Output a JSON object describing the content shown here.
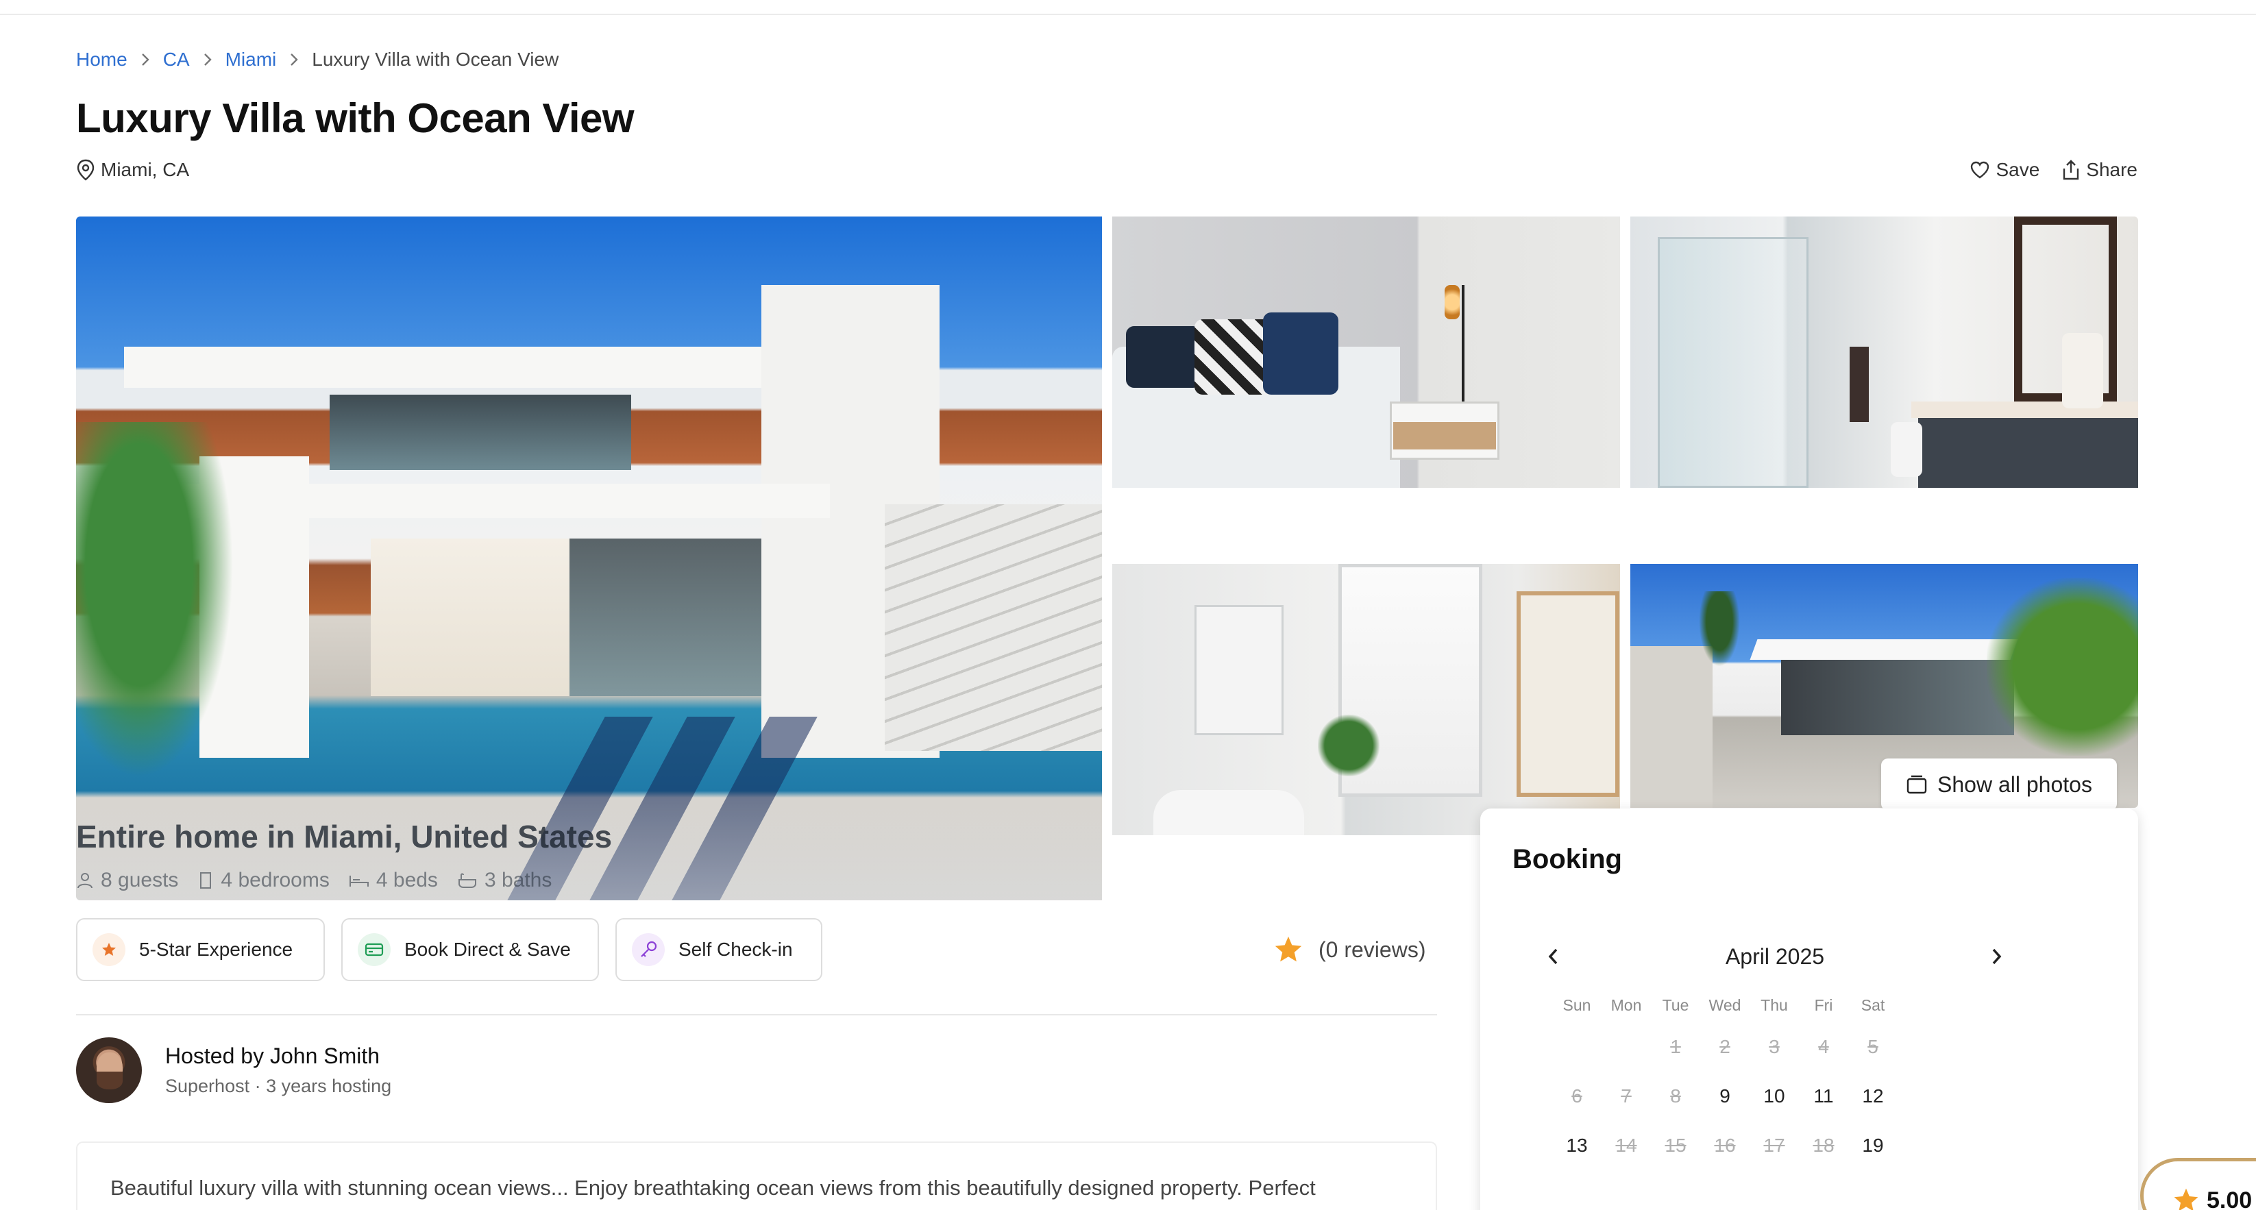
{
  "breadcrumb": {
    "items": [
      {
        "label": "Home"
      },
      {
        "label": "CA"
      },
      {
        "label": "Miami"
      }
    ],
    "current": "Luxury Villa with Ocean View"
  },
  "listing": {
    "title": "Luxury Villa with Ocean View",
    "location": "Miami, CA"
  },
  "actions": {
    "save_label": "Save",
    "share_label": "Share"
  },
  "gallery": {
    "caption_title": "Entire home in Miami, United States",
    "facts": [
      "8 guests",
      "4 bedrooms",
      "4 beds",
      "3 baths"
    ],
    "show_all_label": "Show all photos"
  },
  "highlights": [
    {
      "label": "5-Star Experience",
      "icon": "star-icon",
      "color": "#e8742a"
    },
    {
      "label": "Book Direct & Save",
      "icon": "credit-card-icon",
      "color": "#1f9d55"
    },
    {
      "label": "Self Check-in",
      "icon": "key-icon",
      "color": "#8b3fd6"
    }
  ],
  "rating": {
    "reviews_text": "(0 reviews)",
    "star_color": "#f4a02a"
  },
  "host": {
    "name": "Hosted by John Smith",
    "subtitle": "Superhost · 3 years hosting"
  },
  "description": {
    "text": "Beautiful luxury villa with stunning ocean views... Enjoy breathtaking ocean views from this beautifully designed property. Perfect"
  },
  "booking": {
    "title": "Booking",
    "month": "April 2025",
    "day_names": [
      "Sun",
      "Mon",
      "Tue",
      "Wed",
      "Thu",
      "Fri",
      "Sat"
    ],
    "weeks": [
      [
        null,
        null,
        {
          "d": "1",
          "disabled": true
        },
        {
          "d": "2",
          "disabled": true
        },
        {
          "d": "3",
          "disabled": true
        },
        {
          "d": "4",
          "disabled": true
        },
        {
          "d": "5",
          "disabled": true
        }
      ],
      [
        {
          "d": "6",
          "disabled": true
        },
        {
          "d": "7",
          "disabled": true
        },
        {
          "d": "8",
          "disabled": true
        },
        {
          "d": "9",
          "disabled": false
        },
        {
          "d": "10",
          "disabled": false
        },
        {
          "d": "11",
          "disabled": false
        },
        {
          "d": "12",
          "disabled": false
        }
      ],
      [
        {
          "d": "13",
          "disabled": false
        },
        {
          "d": "14",
          "disabled": true
        },
        {
          "d": "15",
          "disabled": true
        },
        {
          "d": "16",
          "disabled": true
        },
        {
          "d": "17",
          "disabled": true
        },
        {
          "d": "18",
          "disabled": true
        },
        {
          "d": "19",
          "disabled": false
        }
      ]
    ]
  },
  "price_badge": {
    "rating_value": "5.00"
  },
  "colors": {
    "link": "#2f6fd0",
    "accent_star": "#f4a02a",
    "badge_border": "#c8a46a"
  }
}
